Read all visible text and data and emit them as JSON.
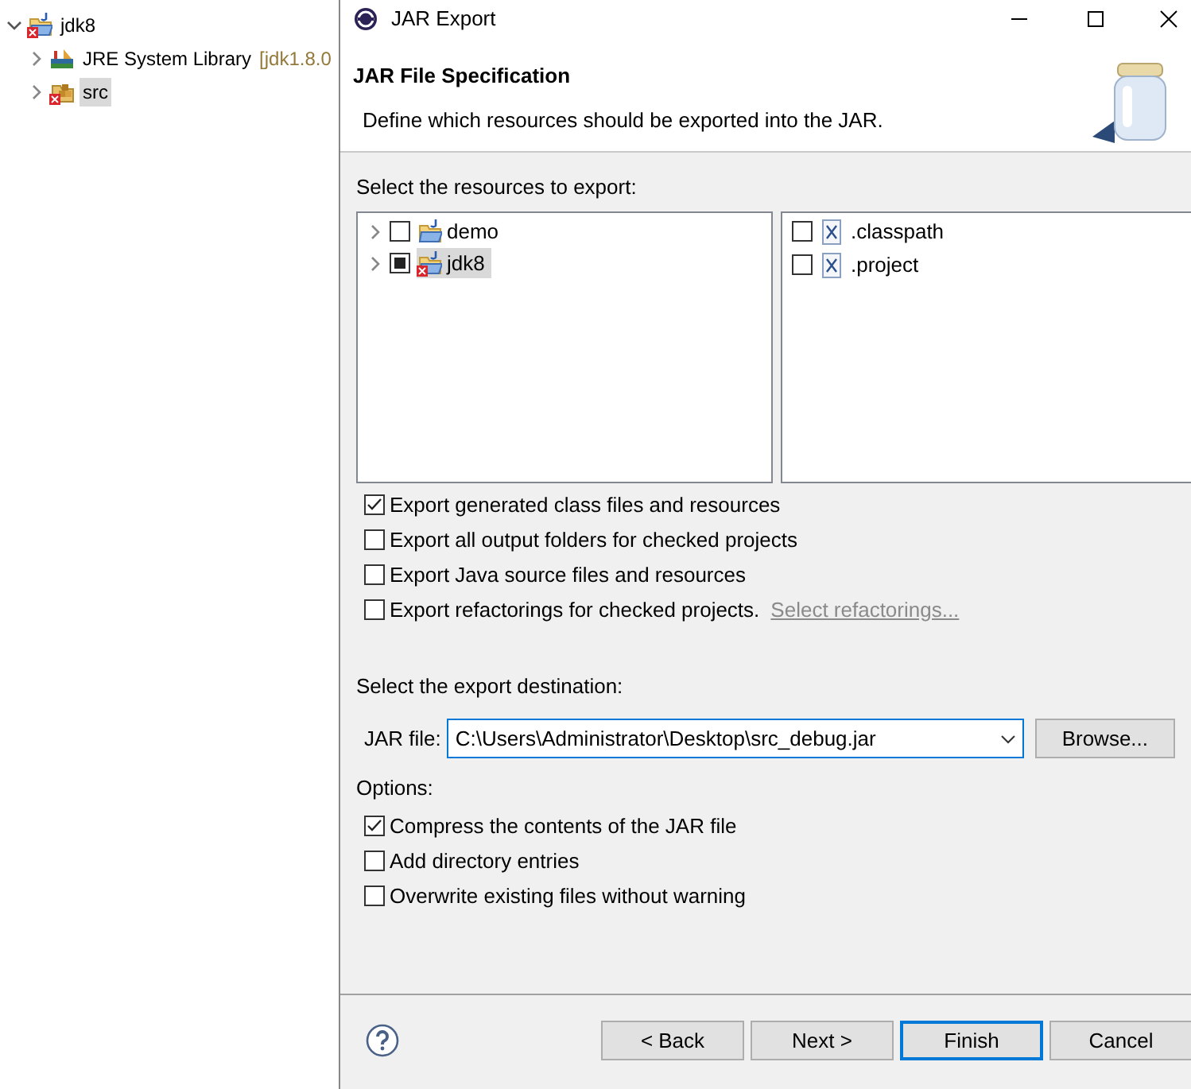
{
  "explorer": {
    "items": [
      {
        "label": "jdk8",
        "kind": "project",
        "expanded": true,
        "selected": false,
        "error": true,
        "children": [
          {
            "label": "JRE System Library",
            "suffix": "[jdk1.8.0",
            "kind": "library",
            "expanded": false,
            "selected": false,
            "error": false
          },
          {
            "label": "src",
            "kind": "package",
            "expanded": false,
            "selected": true,
            "error": true
          }
        ]
      }
    ]
  },
  "dialog": {
    "title": "JAR Export",
    "header": {
      "title": "JAR File Specification",
      "description": "Define which resources should be exported into the JAR."
    },
    "resources": {
      "label": "Select the resources to export:",
      "projects": [
        {
          "label": "demo",
          "checked": false,
          "grayed": false,
          "expanded": false,
          "selected": false,
          "error": false
        },
        {
          "label": "jdk8",
          "checked": true,
          "grayed": true,
          "expanded": false,
          "selected": true,
          "error": true
        }
      ],
      "files": [
        {
          "label": ".classpath",
          "checked": false
        },
        {
          "label": ".project",
          "checked": false
        }
      ]
    },
    "export_options": [
      {
        "label": "Export generated class files and resources",
        "checked": true
      },
      {
        "label": "Export all output folders for checked projects",
        "checked": false
      },
      {
        "label": "Export Java source files and resources",
        "checked": false
      },
      {
        "label": "Export refactorings for checked projects.",
        "checked": false,
        "link": "Select refactorings..."
      }
    ],
    "destination": {
      "label": "Select the export destination:",
      "field_label": "JAR file:",
      "value": "C:\\Users\\Administrator\\Desktop\\src_debug.jar",
      "button": "Browse..."
    },
    "options": {
      "label": "Options:",
      "items": [
        {
          "label": "Compress the contents of the JAR file",
          "checked": true
        },
        {
          "label": "Add directory entries",
          "checked": false
        },
        {
          "label": "Overwrite existing files without warning",
          "checked": false
        }
      ]
    },
    "buttons": [
      {
        "label": "< Back",
        "default": false
      },
      {
        "label": "Next >",
        "default": false
      },
      {
        "label": "Finish",
        "default": true
      },
      {
        "label": "Cancel",
        "default": false
      }
    ]
  }
}
